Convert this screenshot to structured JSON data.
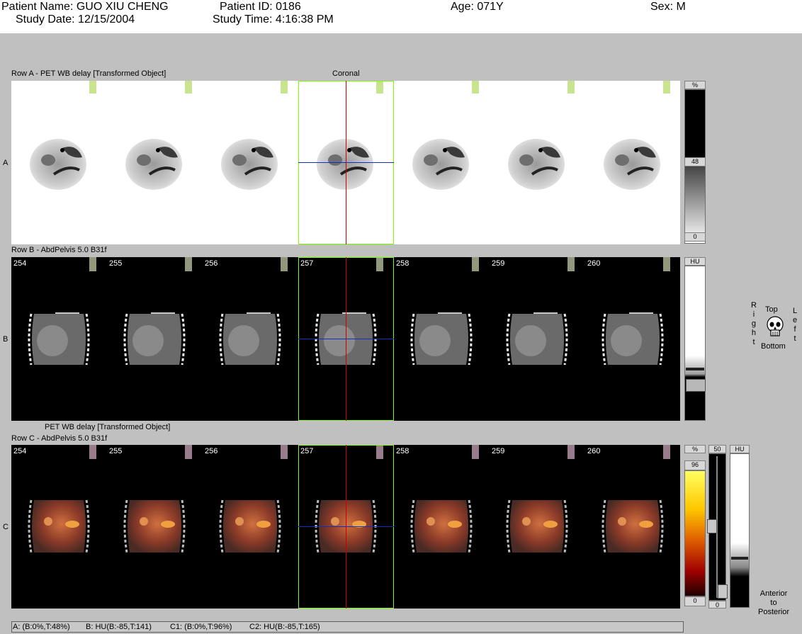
{
  "header": {
    "patient_name": "Patient Name: GUO XIU CHENG",
    "patient_id": "Patient ID: 0186",
    "age": "Age: 071Y",
    "sex": "Sex: M",
    "study_date": "Study Date: 12/15/2004",
    "study_time": "Study Time: 4:16:38 PM"
  },
  "view_title": "Coronal",
  "rows": {
    "a": {
      "letter": "A",
      "label": "Row A - PET WB delay [Transformed Object]"
    },
    "b": {
      "letter": "B",
      "label": "Row B - AbdPelvis  5.0  B31f"
    },
    "c": {
      "letter": "C",
      "label_top": "PET WB delay [Transformed Object]",
      "label": "Row C - AbdPelvis  5.0  B31f"
    }
  },
  "slice_numbers": [
    "254",
    "255",
    "256",
    "257",
    "258",
    "259",
    "260"
  ],
  "colorbars": {
    "a": {
      "unit": "%",
      "mid": "48",
      "min": "0"
    },
    "b": {
      "unit": "HU"
    },
    "c_pet": {
      "unit": "%",
      "max": "96",
      "min": "0"
    },
    "c_slider": {
      "top": "50",
      "bottom": "0"
    },
    "c_ct": {
      "unit": "HU"
    }
  },
  "orientation": {
    "right": "R\ni\ng\nh\nt",
    "top": "Top",
    "bottom": "Bottom",
    "left": "L\ne\nf\nt",
    "depth": "Anterior\nto\nPosterior"
  },
  "status": {
    "a": "A: (B:0%,T:48%)",
    "b": "B: HU(B:-85,T:141)",
    "c1": "C1: (B:0%,T:96%)",
    "c2": "C2: HU(B:-85,T:165)"
  },
  "colors": {
    "selection_box": "#7cfc00",
    "crosshair_vertical": "#d00000",
    "crosshair_horizontal": "#1030c0"
  }
}
